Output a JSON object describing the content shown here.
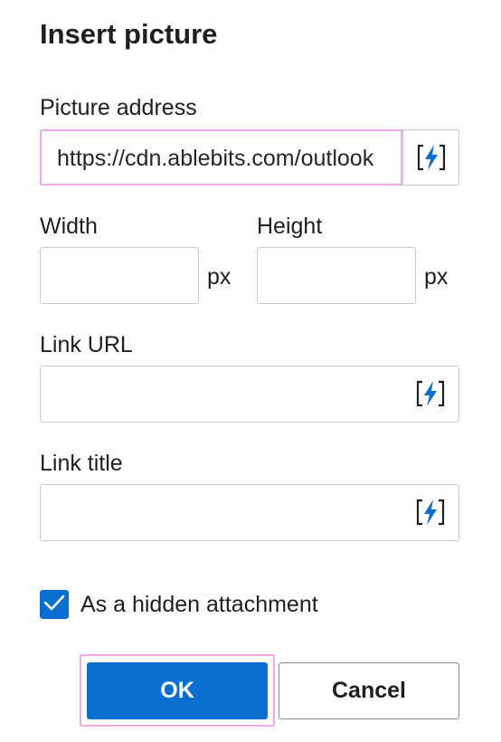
{
  "dialog": {
    "title": "Insert picture"
  },
  "picture_address": {
    "label": "Picture address",
    "value": "https://cdn.ablebits.com/outlook"
  },
  "width": {
    "label": "Width",
    "value": "",
    "unit": "px"
  },
  "height": {
    "label": "Height",
    "value": "",
    "unit": "px"
  },
  "link_url": {
    "label": "Link URL",
    "value": ""
  },
  "link_title": {
    "label": "Link title",
    "value": ""
  },
  "hidden_attachment": {
    "label": "As a hidden attachment",
    "checked": true
  },
  "buttons": {
    "ok_label": "OK",
    "cancel_label": "Cancel"
  },
  "colors": {
    "accent": "#0a6fd0",
    "focus_ring": "#f0a8ee",
    "border": "#c8c8c8"
  },
  "icons": {
    "insert_token": "bracketed-lightning-icon",
    "checkbox": "checkmark-icon"
  }
}
